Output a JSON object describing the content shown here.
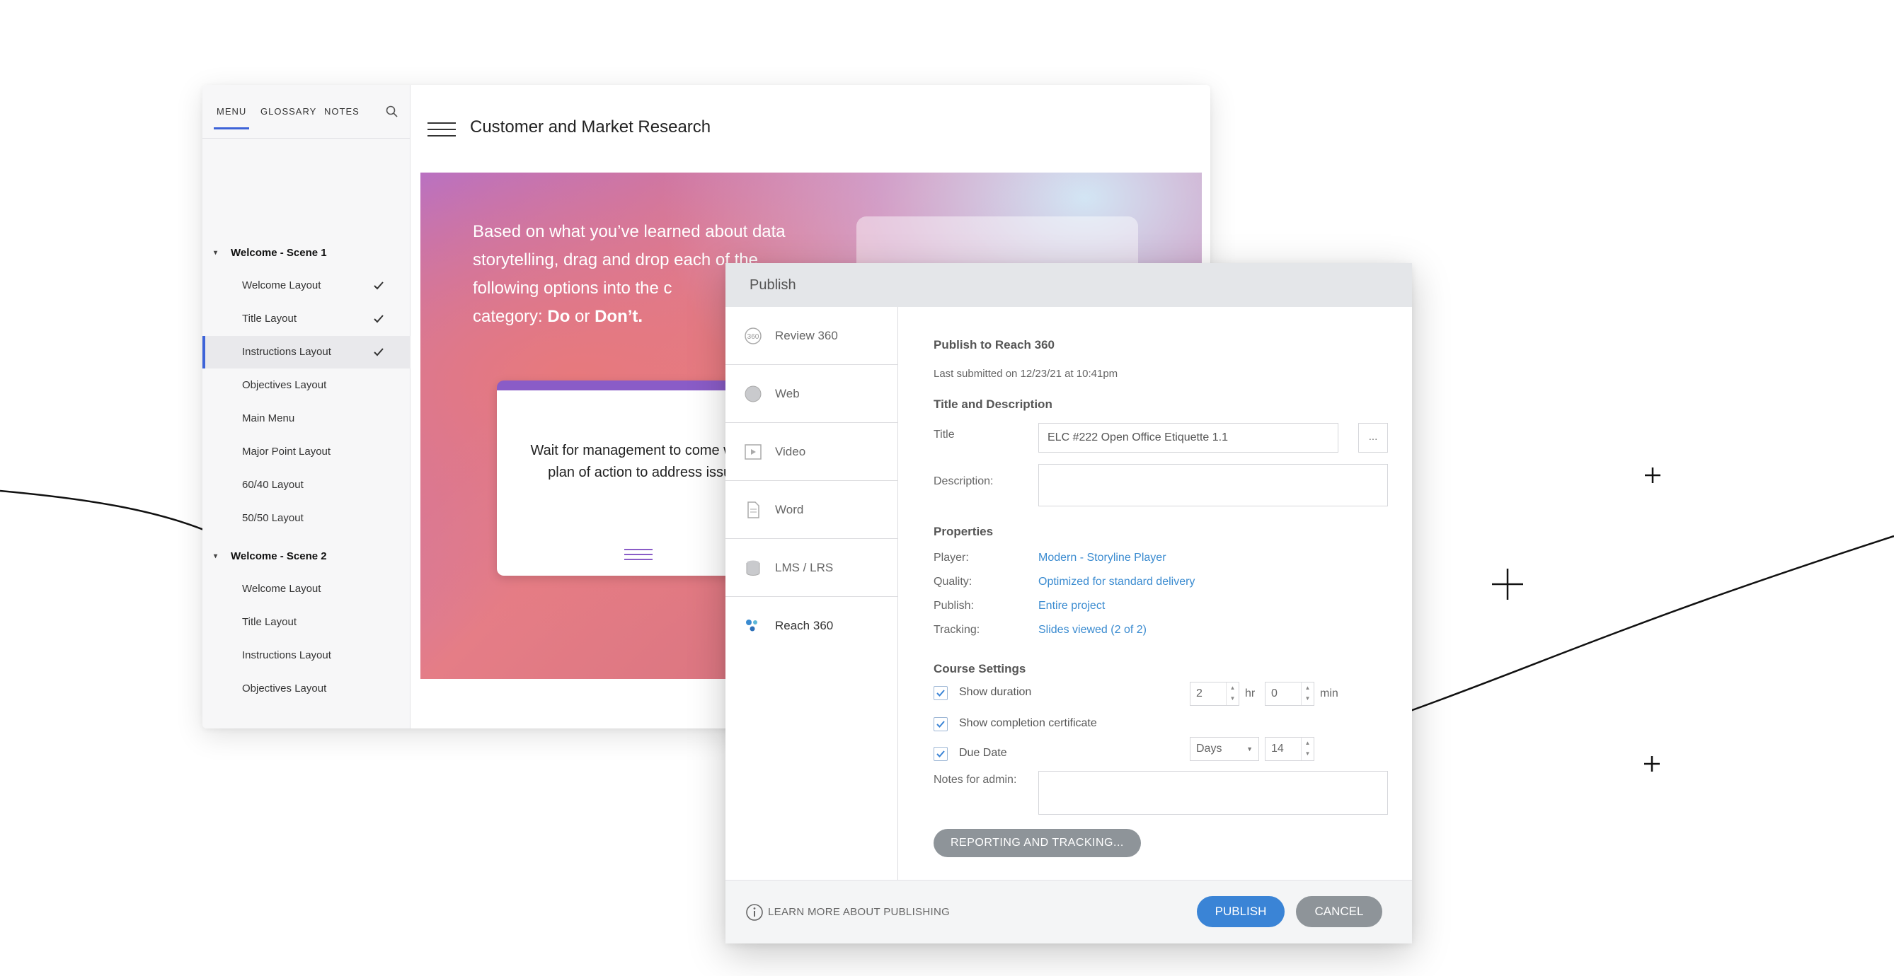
{
  "player": {
    "tabs": [
      "MENU",
      "GLOSSARY",
      "NOTES"
    ],
    "scenes": [
      {
        "title": "Welcome - Scene 1",
        "items": [
          {
            "label": "Welcome Layout",
            "completed": true
          },
          {
            "label": "Title Layout",
            "completed": true
          },
          {
            "label": "Instructions Layout",
            "completed": true,
            "current": true
          },
          {
            "label": "Objectives Layout",
            "completed": false
          },
          {
            "label": "Main Menu",
            "completed": false
          },
          {
            "label": "Major Point Layout",
            "completed": false
          },
          {
            "label": "60/40 Layout",
            "completed": false
          },
          {
            "label": "50/50 Layout",
            "completed": false
          }
        ]
      },
      {
        "title": "Welcome - Scene 2",
        "items": [
          {
            "label": "Welcome Layout",
            "completed": false
          },
          {
            "label": "Title Layout",
            "completed": false
          },
          {
            "label": "Instructions Layout",
            "completed": false
          },
          {
            "label": "Objectives Layout",
            "completed": false
          }
        ]
      }
    ],
    "course_title": "Customer and Market Research",
    "slide": {
      "prompt_part1": "Based on what you’ve learned about data storytelling, drag and drop each of the following options into the c",
      "prompt_line4_prefix": "category: ",
      "prompt_do": "Do",
      "prompt_or": " or ",
      "prompt_dont": "Don’t.",
      "card_text": "Wait for management to come with a plan of action to address issue."
    },
    "accent_color": "#3d63d8"
  },
  "dialog": {
    "title": "Publish",
    "tabs": [
      {
        "label": "Review 360",
        "icon": "review360-icon"
      },
      {
        "label": "Web",
        "icon": "globe-icon"
      },
      {
        "label": "Video",
        "icon": "video-icon"
      },
      {
        "label": "Word",
        "icon": "document-icon"
      },
      {
        "label": "LMS / LRS",
        "icon": "database-icon"
      },
      {
        "label": "Reach 360",
        "icon": "reach360-icon",
        "active": true
      }
    ],
    "heading": "Publish to Reach 360",
    "last_submitted": "Last submitted on 12/23/21 at 10:41pm",
    "title_desc_heading": "Title and Description",
    "title_label": "Title",
    "title_value": "ELC #222 Open Office Etiquette 1.1",
    "ellipsis": "...",
    "description_label": "Description:",
    "description_value": "",
    "properties_heading": "Properties",
    "properties": [
      {
        "label": "Player:",
        "value": "Modern - Storyline Player"
      },
      {
        "label": "Quality:",
        "value": "Optimized for standard delivery"
      },
      {
        "label": "Publish:",
        "value": "Entire project"
      },
      {
        "label": "Tracking:",
        "value": "Slides viewed (2 of 2)"
      }
    ],
    "course_settings_heading": "Course Settings",
    "show_duration": {
      "label": "Show duration",
      "checked": true,
      "hours": "2",
      "hours_unit": "hr",
      "minutes": "0",
      "minutes_unit": "min"
    },
    "show_certificate": {
      "label": "Show completion certificate",
      "checked": true
    },
    "due_date": {
      "label": "Due Date",
      "checked": true,
      "unit": "Days",
      "value": "14"
    },
    "notes_label": "Notes for admin:",
    "notes_value": "",
    "reporting_button": "REPORTING AND TRACKING...",
    "learn_more": "LEARN MORE ABOUT PUBLISHING",
    "publish_button": "PUBLISH",
    "cancel_button": "CANCEL",
    "primary_color": "#3a84d6",
    "secondary_color": "#8e9499"
  }
}
